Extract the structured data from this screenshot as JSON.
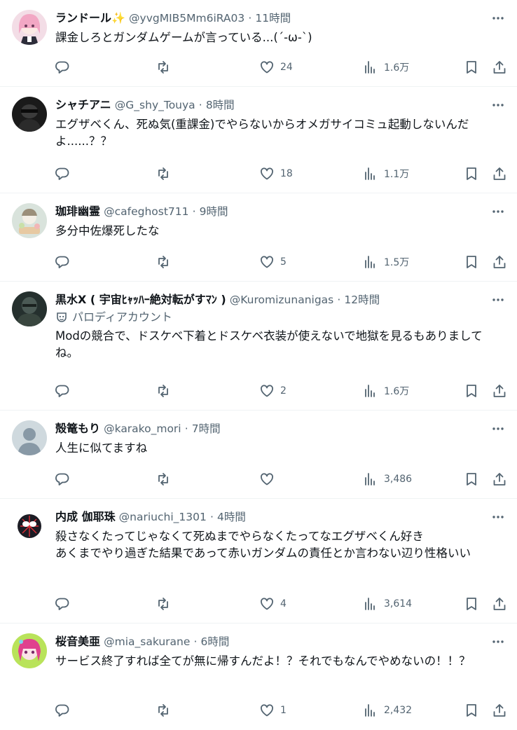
{
  "posts": [
    {
      "name": "ランドール✨",
      "handle": "@yvgMIB5Mm6iRA03",
      "separator": "·",
      "time": "11時間",
      "text": "課金しろとガンダムゲームが言っている...(´-ω-`)",
      "replies": "",
      "reposts": "",
      "likes": "24",
      "views": "1.6万"
    },
    {
      "name": "シャチアニ",
      "handle": "@G_shy_Touya",
      "separator": "·",
      "time": "8時間",
      "text": "エグザベくん、死ぬ気(重課金)でやらないからオメガサイコミュ起動しないんだよ......？？",
      "replies": "",
      "reposts": "",
      "likes": "18",
      "views": "1.1万"
    },
    {
      "name": "珈琲幽霊",
      "handle": "@cafeghost711",
      "separator": "·",
      "time": "9時間",
      "text": "多分中佐爆死したな",
      "replies": "",
      "reposts": "",
      "likes": "5",
      "views": "1.5万"
    },
    {
      "name": "黒水X ( 宇宙ﾋｬｯﾊｰ絶対転がすﾏﾝ )",
      "handle": "@Kuromizunanigas",
      "separator": "·",
      "time": "12時間",
      "label": "パロディアカウント",
      "text": "Modの競合で、ドスケベ下着とドスケベ衣装が使えないで地獄を見るもありましてね。",
      "replies": "",
      "reposts": "",
      "likes": "2",
      "views": "1.6万"
    },
    {
      "name": "殻篭もり",
      "handle": "@karako_mori",
      "separator": "·",
      "time": "7時間",
      "text": "人生に似てますね",
      "replies": "",
      "reposts": "",
      "likes": "",
      "views": "3,486"
    },
    {
      "name": "内成 伽耶珠",
      "handle": "@nariuchi_1301",
      "separator": "·",
      "time": "4時間",
      "text": "殺さなくたってじゃなくて死ぬまでやらなくたってなエグザベくん好き\nあくまでやり過ぎた結果であって赤いガンダムの責任とか言わない辺り性格いい",
      "replies": "",
      "reposts": "",
      "likes": "4",
      "views": "3,614"
    },
    {
      "name": "桜音美亜",
      "handle": "@mia_sakurane",
      "separator": "·",
      "time": "6時間",
      "text": "サービス終了すれば全てが無に帰すんだよ！？それでもなんでやめないの！！？",
      "replies": "",
      "reposts": "",
      "likes": "1",
      "views": "2,432"
    }
  ],
  "icons": {
    "reply": "reply-icon",
    "repost": "repost-icon",
    "like": "heart-icon",
    "views": "views-chart-icon",
    "bookmark": "bookmark-icon",
    "share": "share-icon",
    "more": "more-icon",
    "parody": "mask-icon"
  },
  "colors": {
    "text": "#0f1419",
    "secondary": "#536471",
    "divider": "#eff3f4"
  }
}
